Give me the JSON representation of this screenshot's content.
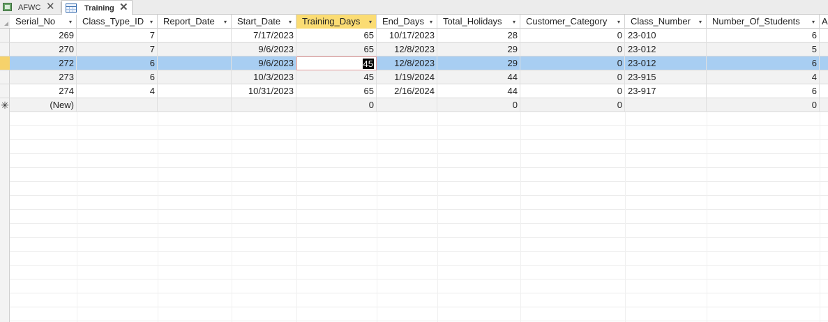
{
  "tabs": [
    {
      "label": "AFWC",
      "icon": "form-icon"
    },
    {
      "label": "Training",
      "icon": "table-icon",
      "active": true
    }
  ],
  "columns": [
    "Serial_No",
    "Class_Type_ID",
    "Report_Date",
    "Start_Date",
    "Training_Days",
    "End_Days",
    "Total_Holidays",
    "Customer_Category",
    "Class_Number",
    "Number_Of_Students",
    "A"
  ],
  "rows": [
    {
      "serial_no": "269",
      "class_type_id": "7",
      "report_date": "",
      "start_date": "7/17/2023",
      "training_days": "65",
      "end_days": "10/17/2023",
      "total_holidays": "28",
      "customer_category": "0",
      "class_number": "23-010",
      "number_of_students": "6"
    },
    {
      "serial_no": "270",
      "class_type_id": "7",
      "report_date": "",
      "start_date": "9/6/2023",
      "training_days": "65",
      "end_days": "12/8/2023",
      "total_holidays": "29",
      "customer_category": "0",
      "class_number": "23-012",
      "number_of_students": "5"
    },
    {
      "serial_no": "272",
      "class_type_id": "6",
      "report_date": "",
      "start_date": "9/6/2023",
      "training_days": "45",
      "end_days": "12/8/2023",
      "total_holidays": "29",
      "customer_category": "0",
      "class_number": "23-012",
      "number_of_students": "6"
    },
    {
      "serial_no": "273",
      "class_type_id": "6",
      "report_date": "",
      "start_date": "10/3/2023",
      "training_days": "45",
      "end_days": "1/19/2024",
      "total_holidays": "44",
      "customer_category": "0",
      "class_number": "23-915",
      "number_of_students": "4"
    },
    {
      "serial_no": "274",
      "class_type_id": "4",
      "report_date": "",
      "start_date": "10/31/2023",
      "training_days": "65",
      "end_days": "2/16/2024",
      "total_holidays": "44",
      "customer_category": "0",
      "class_number": "23-917",
      "number_of_students": "6"
    }
  ],
  "new_row": {
    "serial_no": "(New)",
    "training_days": "0",
    "total_holidays": "0",
    "customer_category": "0",
    "number_of_students": "0",
    "marker": "✳"
  },
  "close_glyph": "✕",
  "dropdown_glyph": "▾",
  "colors": {
    "active_header": "#fbdc73",
    "selected_row": "#a8cef2",
    "current_record": "#f6d26b"
  }
}
